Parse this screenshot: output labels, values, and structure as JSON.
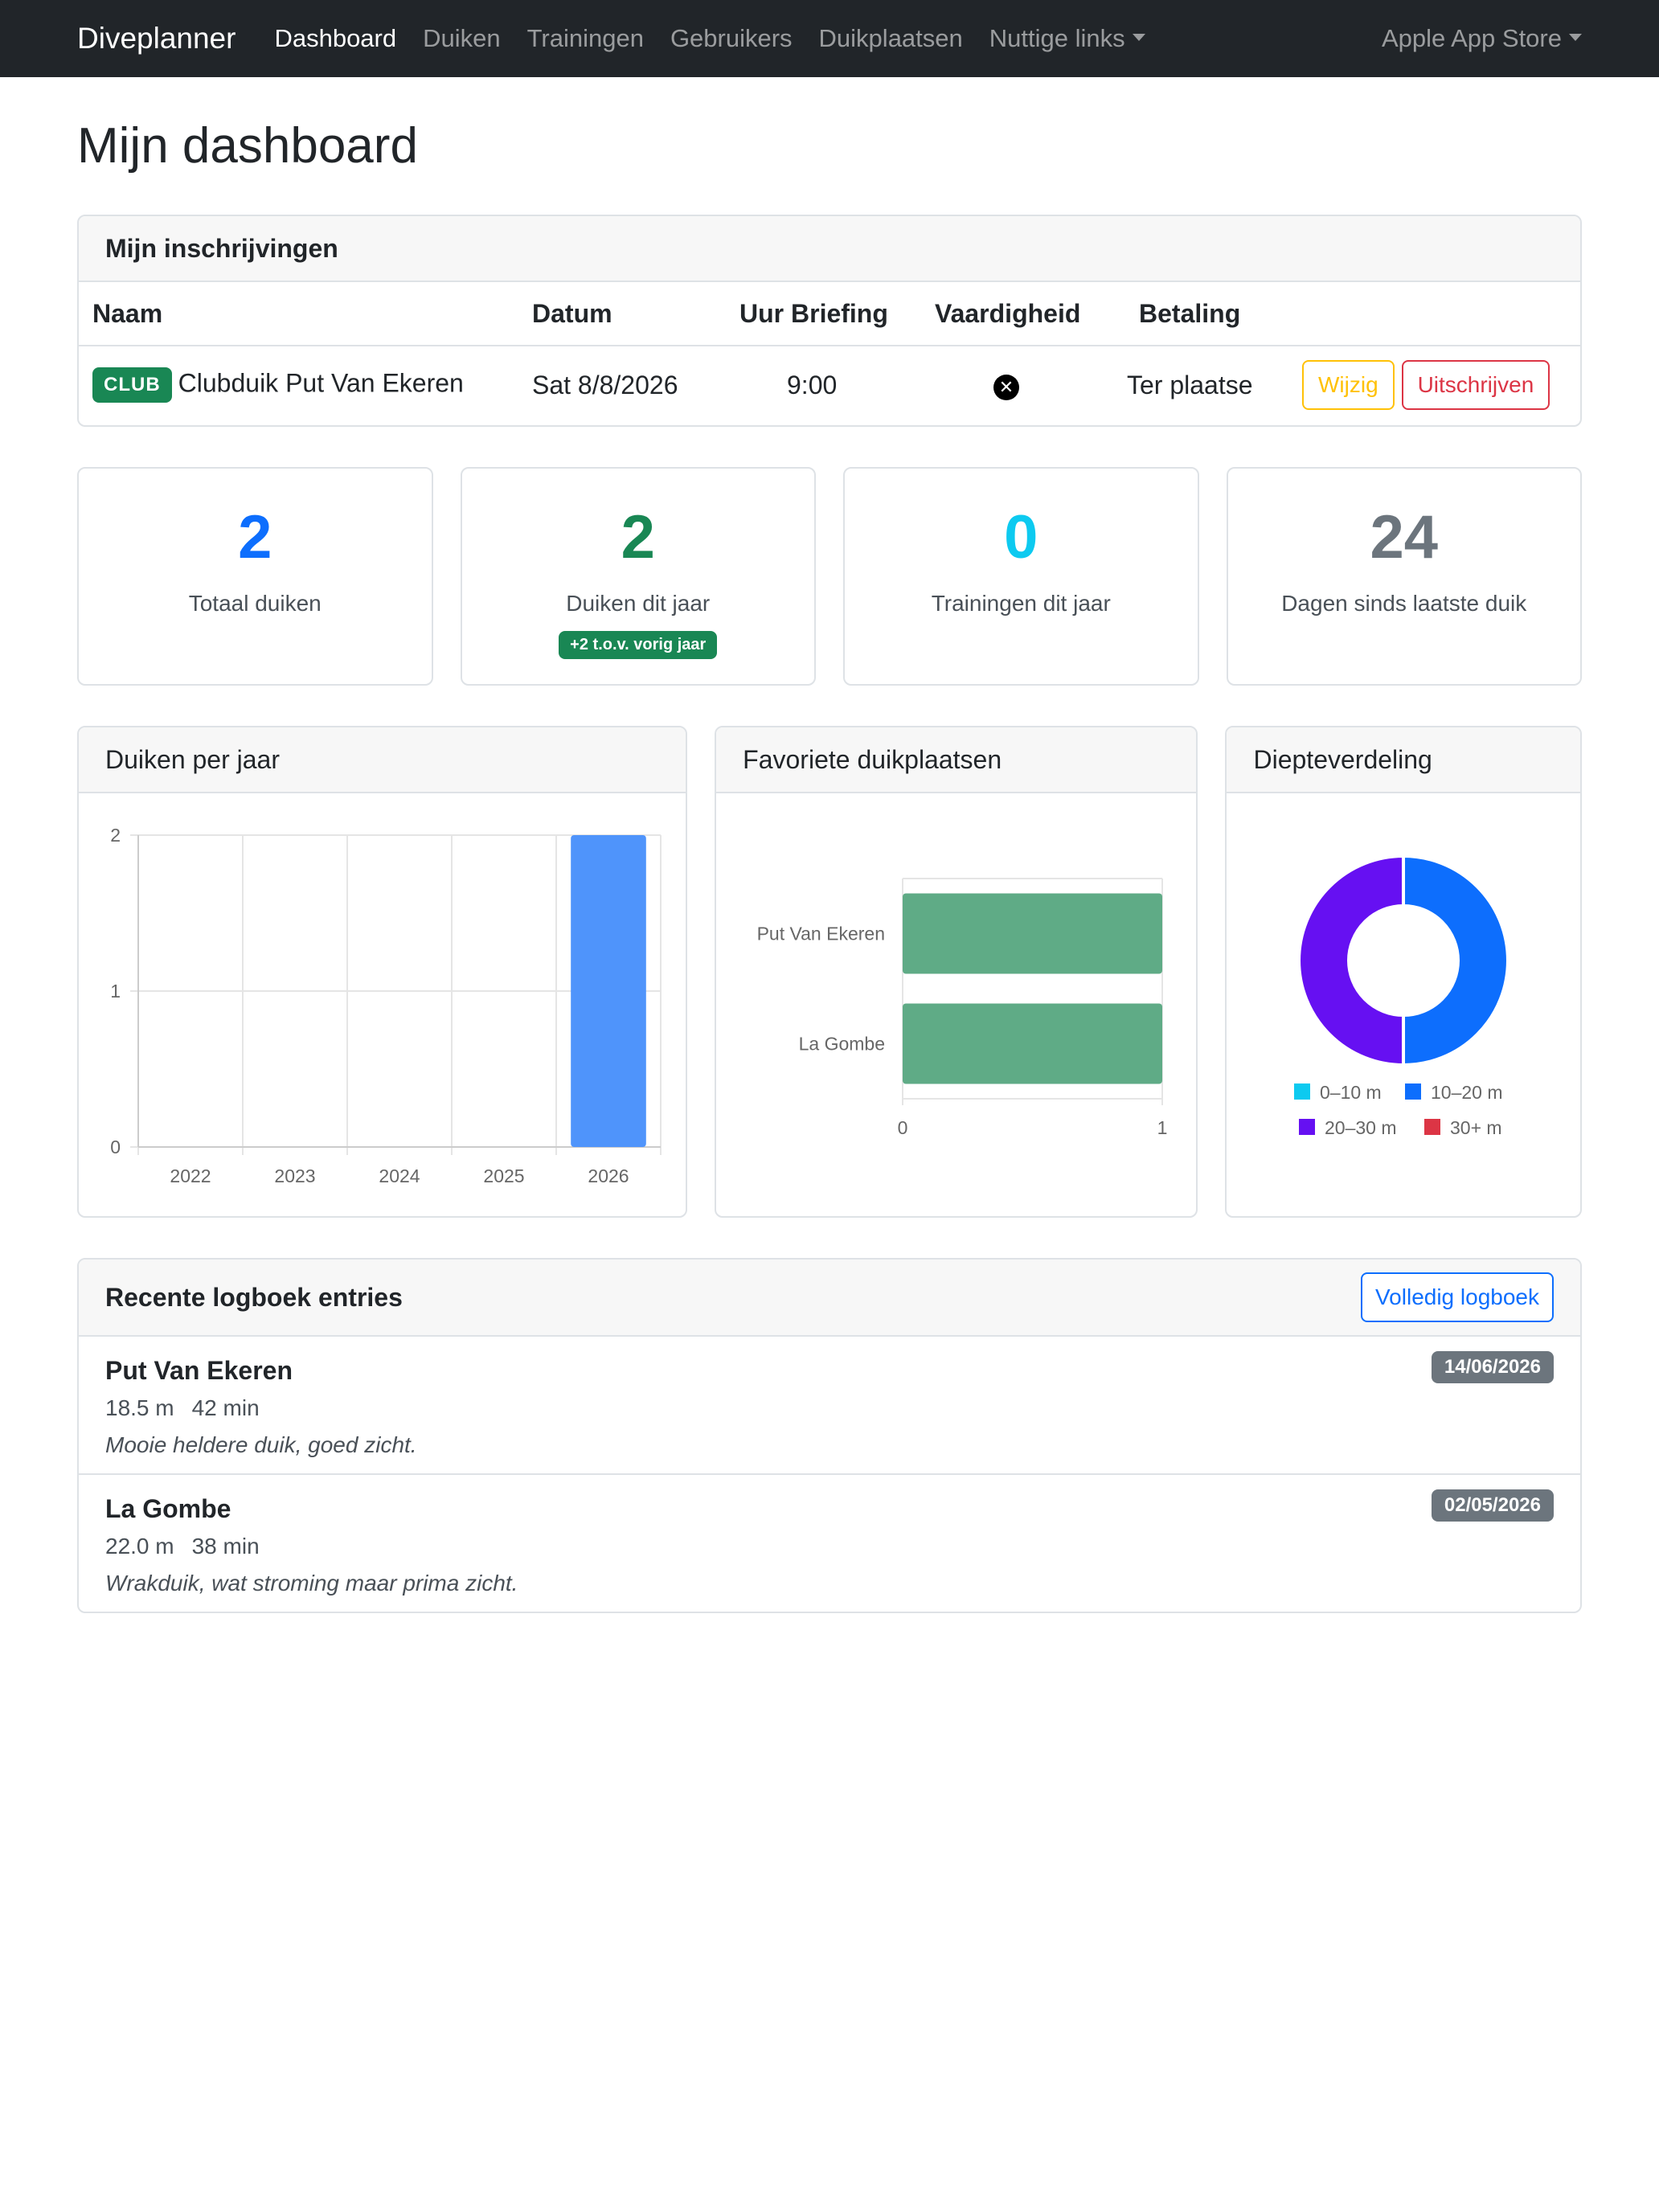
{
  "navbar": {
    "brand": "Diveplanner",
    "items": [
      {
        "label": "Dashboard",
        "active": true
      },
      {
        "label": "Duiken"
      },
      {
        "label": "Trainingen"
      },
      {
        "label": "Gebruikers"
      },
      {
        "label": "Duikplaatsen"
      },
      {
        "label": "Nuttige links",
        "dropdown": true
      }
    ],
    "right": {
      "label": "Apple App Store",
      "dropdown": true
    }
  },
  "page": {
    "title": "Mijn dashboard"
  },
  "registrations": {
    "title": "Mijn inschrijvingen",
    "columns": [
      "Naam",
      "Datum",
      "Uur Briefing",
      "Vaardigheid",
      "Betaling"
    ],
    "rows": [
      {
        "badge": "CLUB",
        "name": "Clubduik Put Van Ekeren",
        "date": "Sat 8/8/2026",
        "briefing": "9:00",
        "skill_icon": "x-circle-icon",
        "payment": "Ter plaatse",
        "edit_label": "Wijzig",
        "unsubscribe_label": "Uitschrijven"
      }
    ]
  },
  "stats": [
    {
      "value": "2",
      "label": "Totaal duiken",
      "color": "#0d6efd"
    },
    {
      "value": "2",
      "label": "Duiken dit jaar",
      "color": "#198754",
      "delta": "+2 t.o.v. vorig jaar"
    },
    {
      "value": "0",
      "label": "Trainingen dit jaar",
      "color": "#0dcaf0"
    },
    {
      "value": "24",
      "label": "Dagen sinds laatste duik",
      "color": "#6c757d"
    }
  ],
  "charts": {
    "per_year_title": "Duiken per jaar",
    "sites_title": "Favoriete duikplaatsen",
    "depth_title": "Diepteverdeling"
  },
  "chart_data": [
    {
      "type": "bar",
      "title": "Duiken per jaar",
      "categories": [
        "2022",
        "2023",
        "2024",
        "2025",
        "2026"
      ],
      "values": [
        0,
        0,
        0,
        0,
        2
      ],
      "ylim": [
        0,
        2
      ],
      "yticks": [
        "0",
        "1",
        "2"
      ],
      "color": "#4f94fb",
      "grid": true
    },
    {
      "type": "bar",
      "orientation": "horizontal",
      "title": "Favoriete duikplaatsen",
      "categories": [
        "Put Van Ekeren",
        "La Gombe"
      ],
      "values": [
        1,
        1
      ],
      "xlim": [
        0,
        1
      ],
      "xticks": [
        "0",
        "1"
      ],
      "color": "#5fab86"
    },
    {
      "type": "pie",
      "variant": "doughnut",
      "title": "Diepteverdeling",
      "labels": [
        "0–10 m",
        "10–20 m",
        "20–30 m",
        "30+ m"
      ],
      "values": [
        0,
        1,
        1,
        0
      ],
      "colors": [
        "#0dcaf0",
        "#0d6efd",
        "#6610f2",
        "#dc3545"
      ],
      "legend": "bottom"
    }
  ],
  "logbook": {
    "title": "Recente logboek entries",
    "full_label": "Volledig logboek",
    "entries": [
      {
        "site": "Put Van Ekeren",
        "depth": "18.5 m",
        "duration": "42 min",
        "note": "Mooie heldere duik, goed zicht.",
        "date": "14/06/2026"
      },
      {
        "site": "La Gombe",
        "depth": "22.0 m",
        "duration": "38 min",
        "note": "Wrakduik, wat stroming maar prima zicht.",
        "date": "02/05/2026"
      }
    ]
  }
}
